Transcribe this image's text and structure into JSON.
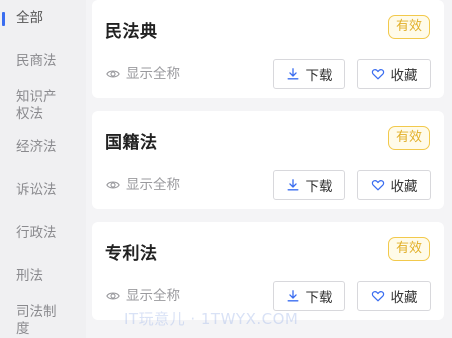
{
  "sidebar": {
    "items": [
      {
        "label": "全部",
        "active": true
      },
      {
        "label": "民商法"
      },
      {
        "label": "知识产"
      },
      {
        "label": "权法"
      },
      {
        "label": "经济法"
      },
      {
        "label": "诉讼法"
      },
      {
        "label": "行政法"
      },
      {
        "label": "刑法"
      },
      {
        "label": "司法制"
      },
      {
        "label": "度"
      }
    ],
    "accent_color": "#3a6df0"
  },
  "cards": [
    {
      "title": "民法典",
      "badge": "有效",
      "fullname_label": "显示全称",
      "download_label": "下载",
      "collect_label": "收藏"
    },
    {
      "title": "国籍法",
      "badge": "有效",
      "fullname_label": "显示全称",
      "download_label": "下载",
      "collect_label": "收藏"
    },
    {
      "title": "专利法",
      "badge": "有效",
      "fullname_label": "显示全称",
      "download_label": "下载",
      "collect_label": "收藏"
    }
  ],
  "badge_color": "#f2c94c",
  "icons": {
    "fullname": "eye-icon",
    "download": "download-icon",
    "collect": "heart-icon"
  },
  "watermark": "IT玩意儿 · 1TWYX.COM"
}
